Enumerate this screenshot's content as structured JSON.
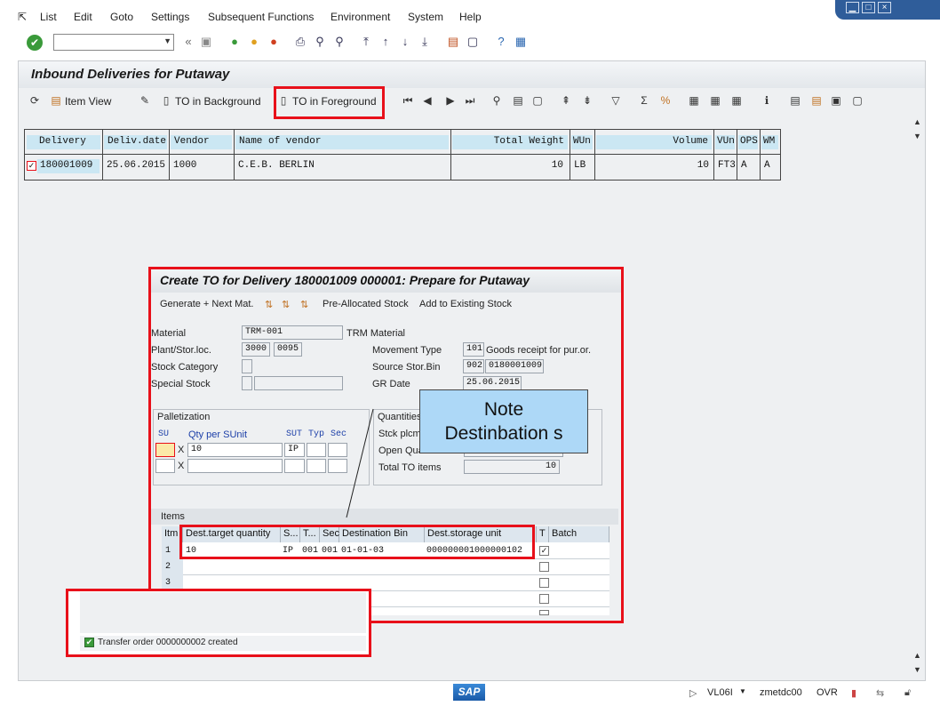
{
  "window": {
    "minimize": "▁",
    "maximize": "□",
    "close": "×"
  },
  "menu": [
    "List",
    "Edit",
    "Goto",
    "Settings",
    "Subsequent Functions",
    "Environment",
    "System",
    "Help"
  ],
  "screen_title": "Inbound Deliveries for Putaway",
  "app_toolbar": {
    "item_view": "Item View",
    "to_background": "TO in Background",
    "to_foreground": "TO in Foreground"
  },
  "grid": {
    "headers": [
      "Delivery",
      "Deliv.date",
      "Vendor",
      "Name of vendor",
      "Total Weight",
      "WUn",
      "Volume",
      "VUn",
      "OPS",
      "WM"
    ],
    "row": {
      "checked": "✓",
      "delivery": "180001009",
      "date": "25.06.2015",
      "vendor": "1000",
      "name": "C.E.B. BERLIN",
      "weight": "10",
      "wun": "LB",
      "volume": "10",
      "vun": "FT3",
      "ops": "A",
      "wm": "A"
    }
  },
  "popup": {
    "title": "Create TO for Delivery 180001009 000001: Prepare for Putaway",
    "toolbar": {
      "generate": "Generate + Next Mat.",
      "pre_allocated": "Pre-Allocated Stock",
      "add_existing": "Add to Existing Stock"
    },
    "fields": {
      "material_label": "Material",
      "material_value": "TRM-001",
      "material_desc": "TRM Material",
      "plant_label": "Plant/Stor.loc.",
      "plant_value": "3000",
      "sloc_value": "0095",
      "stock_cat_label": "Stock Category",
      "special_stock_label": "Special Stock",
      "movement_label": "Movement Type",
      "movement_value": "101",
      "movement_desc": "Goods receipt for pur.or.",
      "source_bin_label": "Source Stor.Bin",
      "source_type": "902",
      "source_bin": "0180001009",
      "gr_date_label": "GR Date",
      "gr_date_value": "25.06.2015"
    },
    "palletization": {
      "title": "Palletization",
      "col_su": "SU",
      "col_qty": "Qty per SUnit",
      "col_sut": "SUT",
      "col_typ": "Typ",
      "col_sec": "Sec",
      "x1": "X",
      "x2": "X",
      "qty1": "10",
      "sut1": "IP"
    },
    "quantities": {
      "title": "Quantities",
      "stock_placement": "Stck plcm",
      "open_quantity": "Open Qua",
      "total_items_label": "Total TO items",
      "total_items_value": "10"
    },
    "items": {
      "title": "Items",
      "headers": [
        "Itm",
        "Dest.target quantity",
        "S...",
        "T...",
        "Sec",
        "Destination Bin",
        "Dest.storage unit",
        "T",
        "Batch"
      ],
      "row1": {
        "itm": "1",
        "qty": "10",
        "s": "IP",
        "t": "001",
        "sec": "001",
        "bin": "01-01-03",
        "su": "000000001000000102",
        "check": "✓"
      },
      "row_numbers": [
        "2",
        "3"
      ]
    }
  },
  "callout": {
    "line1": "Note",
    "line2": "Destinbation s"
  },
  "message": "Transfer order 0000000002 created",
  "status": {
    "logo": "SAP",
    "tcode": "VL06I",
    "server": "zmetdc00",
    "mode": "OVR"
  },
  "colors": {
    "highlight": "#e8101a",
    "header_blue": "#cbe7f3",
    "callout_blue": "#add8f7"
  }
}
